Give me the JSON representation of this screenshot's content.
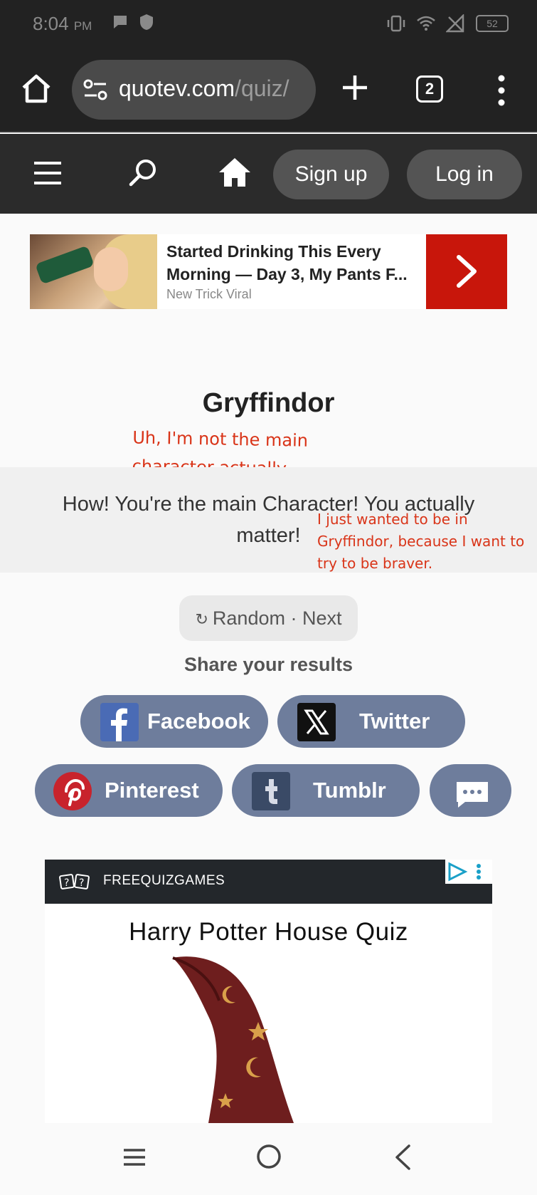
{
  "status_bar": {
    "time": "8:04",
    "ampm": "PM",
    "battery": "52",
    "icons": [
      "chat-bubble-icon",
      "shield-icon",
      "vibrate-icon",
      "wifi-icon",
      "no-signal-icon",
      "battery-icon"
    ]
  },
  "browser": {
    "url_host": "quotev.com",
    "url_path": "/quiz/",
    "tab_count": "2",
    "icons": [
      "home-icon",
      "site-settings-icon",
      "new-tab-plus-icon",
      "tab-switcher-icon",
      "more-vert-icon"
    ]
  },
  "site_nav": {
    "signup_label": "Sign up",
    "login_label": "Log in",
    "icons": [
      "hamburger-menu-icon",
      "search-icon",
      "home-icon"
    ]
  },
  "ad_banner": {
    "title": "Started Drinking This Every Morning — Day 3, My Pants F...",
    "source": "New Trick Viral",
    "cta_icon": "chevron-right-icon",
    "cta_color": "#c8160b"
  },
  "result": {
    "title": "Gryffindor",
    "description": "How! You're the main Character! You actually matter!",
    "annotation_1": "Uh, I'm not the main character actually...",
    "annotation_2": "I just wanted to be in Gryffindor, because I want to try to be braver.",
    "annotation_color": "#d93418"
  },
  "actions": {
    "random_next": "Random · Next",
    "share_heading": "Share your results"
  },
  "share": {
    "facebook": "Facebook",
    "twitter": "Twitter",
    "pinterest": "Pinterest",
    "tumblr": "Tumblr",
    "more_icon": "comment-bubble-icon",
    "button_color": "#6e7d9c"
  },
  "game_ad": {
    "brand": "FREEQUIZGAMES",
    "title": "Harry Potter House Quiz",
    "icons": [
      "quiz-logo-icon",
      "adchoices-icon",
      "wizard-hat-icon"
    ]
  },
  "nav_bar": {
    "icons": [
      "recents-menu-icon",
      "home-circle-icon",
      "back-chevron-icon"
    ]
  }
}
